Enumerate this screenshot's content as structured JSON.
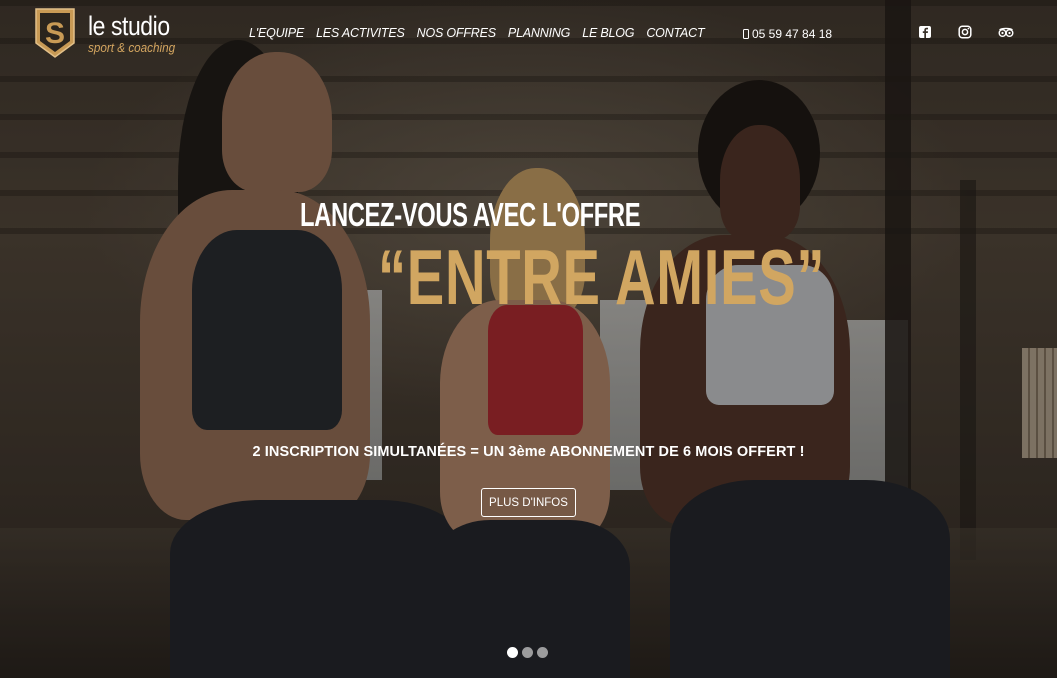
{
  "brand": {
    "name": "le studio",
    "tagline": "sport & coaching",
    "badge_letter": "S",
    "accent_color": "#d1a661"
  },
  "nav": {
    "items": [
      {
        "label": "L'EQUIPE"
      },
      {
        "label": "LES ACTIVITES"
      },
      {
        "label": "NOS OFFRES"
      },
      {
        "label": "PLANNING"
      },
      {
        "label": "LE BLOG"
      },
      {
        "label": "CONTACT"
      }
    ],
    "phone": "05 59 47 84 18",
    "phone_icon": "mobile-phone-icon",
    "socials": [
      {
        "icon": "facebook-icon"
      },
      {
        "icon": "instagram-icon"
      },
      {
        "icon": "tripadvisor-icon"
      }
    ]
  },
  "slide": {
    "headline": "LANCEZ-VOUS AVEC L'OFFRE",
    "highlight": "“ENTRE AMIES”",
    "subtext": "2 INSCRIPTION SIMULTANÉES = UN 3ème ABONNEMENT DE 6 MOIS OFFERT !",
    "cta_label": "PLUS D'INFOS"
  },
  "carousel": {
    "total": 3,
    "active_index": 0
  }
}
